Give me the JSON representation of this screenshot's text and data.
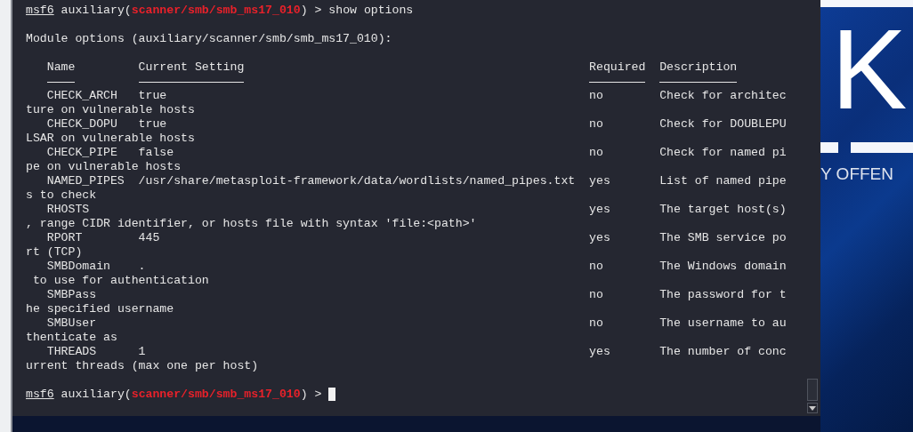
{
  "first_prompt": {
    "user": "msf6",
    "module_open": "auxiliary(",
    "module": "scanner/smb/smb_ms17_010",
    "module_close": ") >",
    "command": "show options"
  },
  "heading": "Module options (auxiliary/scanner/smb/smb_ms17_010):",
  "columns": [
    "Name",
    "Current Setting",
    "Required",
    "Description"
  ],
  "options": [
    {
      "name": "CHECK_ARCH",
      "setting": "true",
      "required": "no",
      "description": "Check for architec",
      "wrap": "ture on vulnerable hosts"
    },
    {
      "name": "CHECK_DOPU",
      "setting": "true",
      "required": "no",
      "description": "Check for DOUBLEPU",
      "wrap": "LSAR on vulnerable hosts"
    },
    {
      "name": "CHECK_PIPE",
      "setting": "false",
      "required": "no",
      "description": "Check for named pi",
      "wrap": "pe on vulnerable hosts"
    },
    {
      "name": "NAMED_PIPES",
      "setting": "/usr/share/metasploit-framework/data/wordlists/named_pipes.txt",
      "required": "yes",
      "description": "List of named pipe",
      "wrap": "s to check"
    },
    {
      "name": "RHOSTS",
      "required": "yes",
      "description": "The target host(s)",
      "wrap": ", range CIDR identifier, or hosts file with syntax 'file:<path>'"
    },
    {
      "name": "RPORT",
      "setting": "445",
      "required": "yes",
      "description": "The SMB service po",
      "wrap": "rt (TCP)"
    },
    {
      "name": "SMBDomain",
      "setting": ".",
      "required": "no",
      "description": "The Windows domain",
      "wrap": " to use for authentication"
    },
    {
      "name": "SMBPass",
      "required": "no",
      "description": "The password for t",
      "wrap": "he specified username"
    },
    {
      "name": "SMBUser",
      "required": "no",
      "description": "The username to au",
      "wrap": "thenticate as"
    },
    {
      "name": "THREADS",
      "setting": "1",
      "required": "yes",
      "description": "The number of conc",
      "wrap": "urrent threads (max one per host)"
    }
  ],
  "last_prompt": {
    "user": "msf6",
    "module_open": "auxiliary(",
    "module": "scanner/smb/smb_ms17_010",
    "module_close": ") >",
    "cursor": true
  },
  "wallpaper": {
    "logo_letter": "K",
    "tagline": "Y OFFEN"
  }
}
